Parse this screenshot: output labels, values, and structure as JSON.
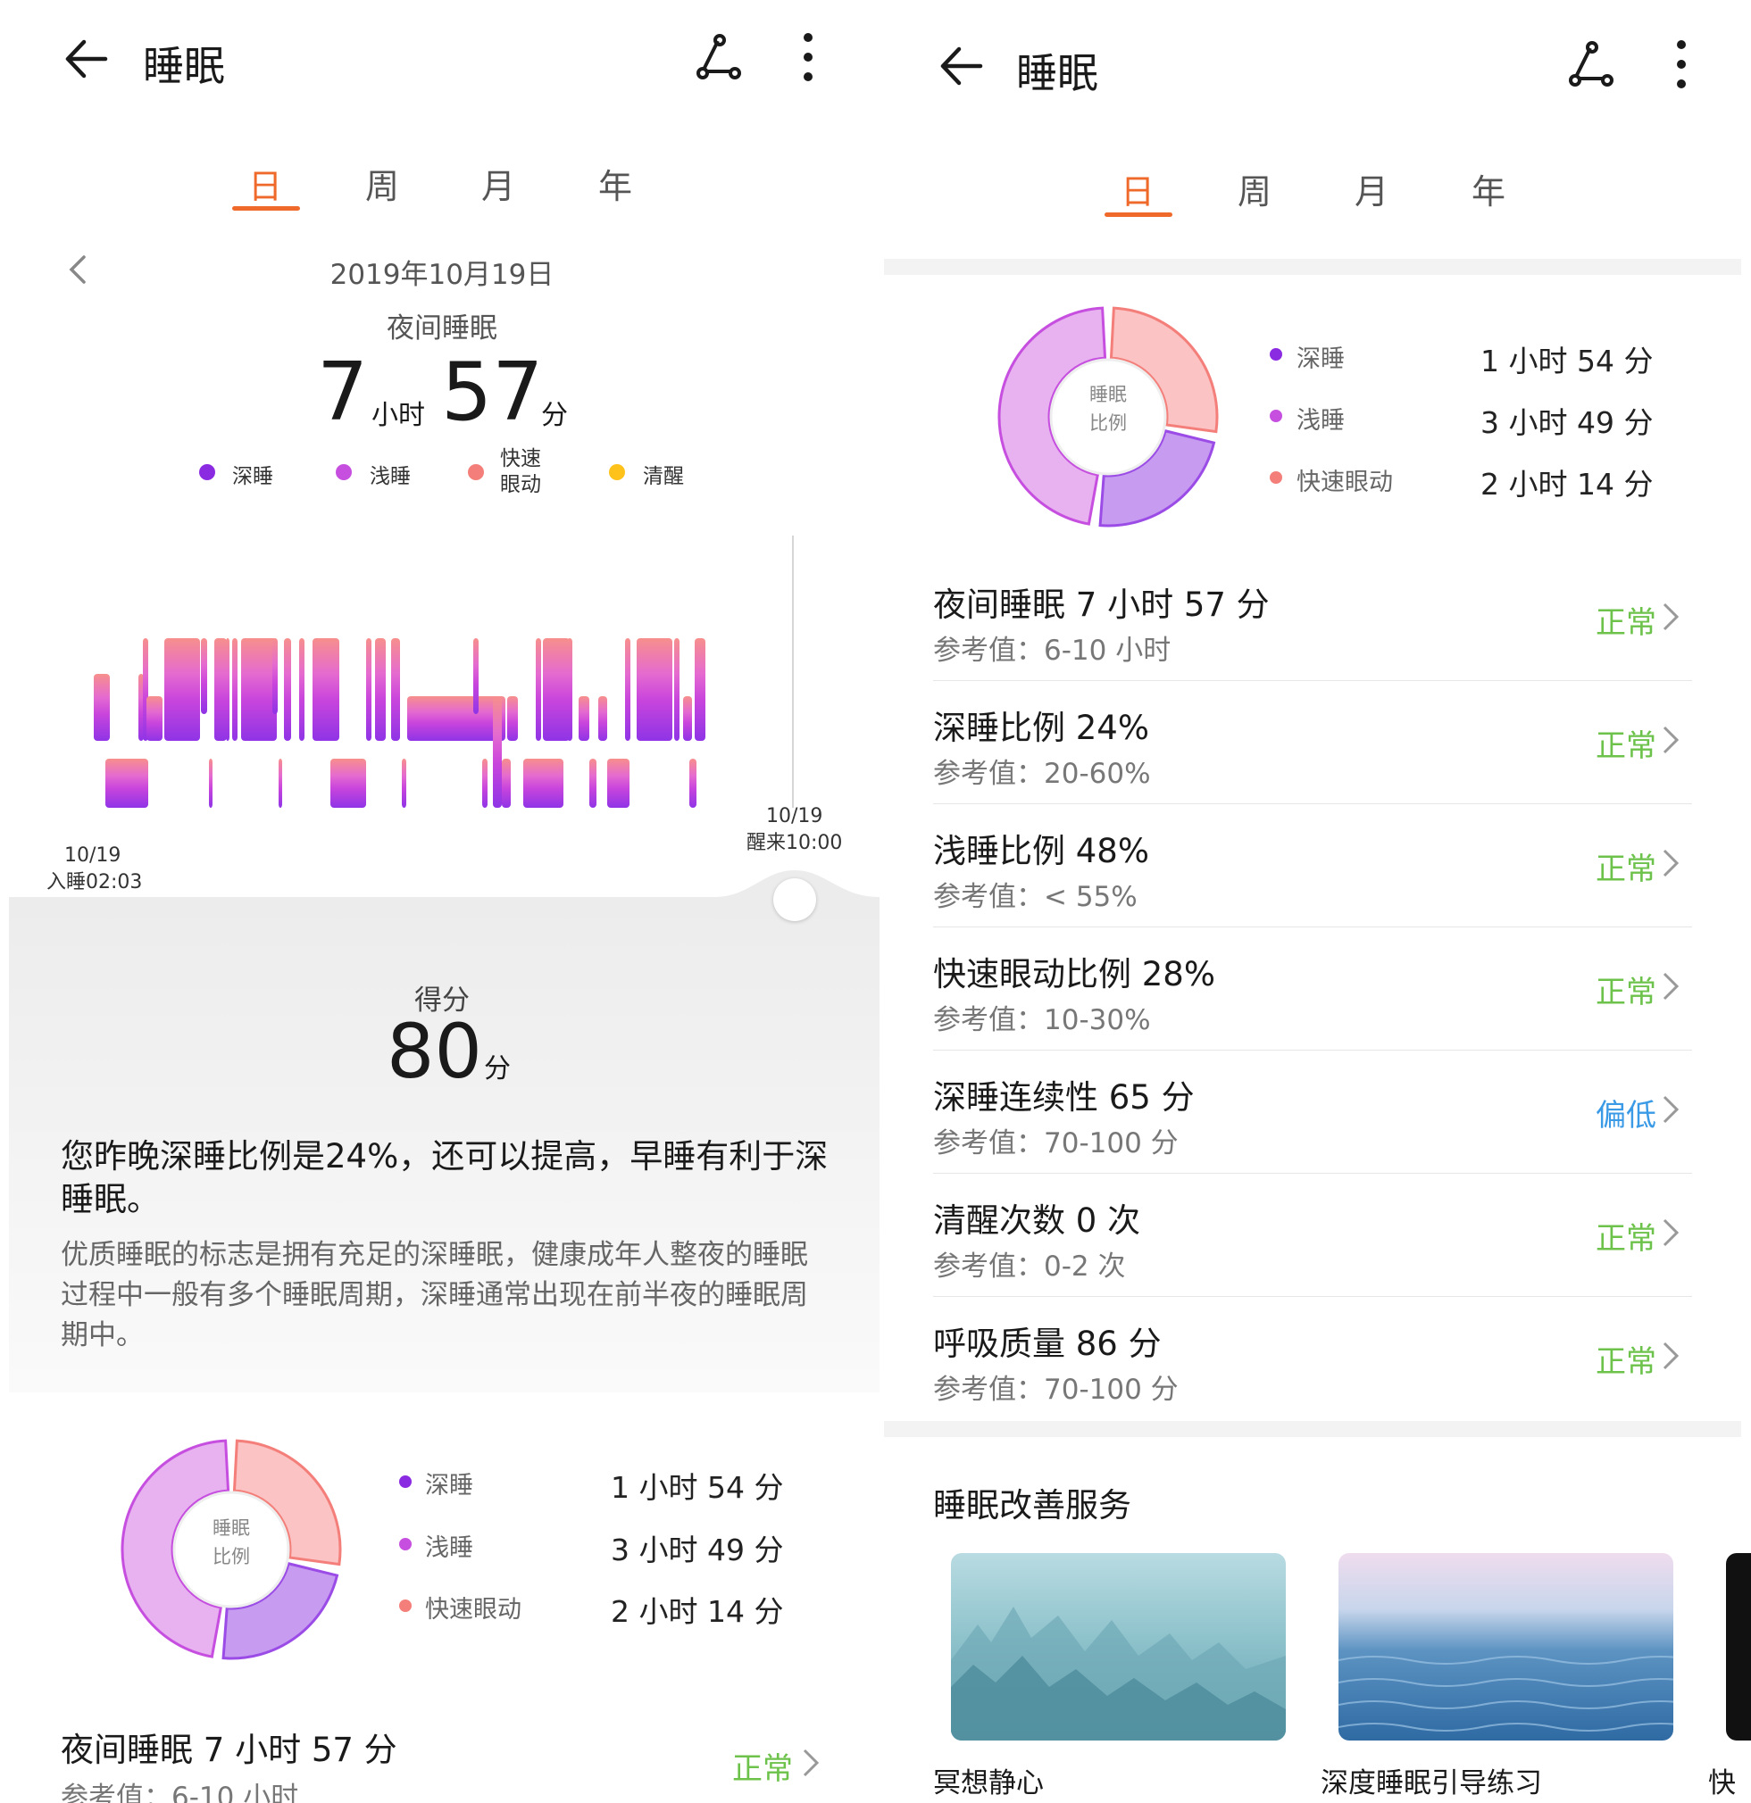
{
  "header": {
    "title": "睡眠"
  },
  "tabs": [
    "日",
    "周",
    "月",
    "年"
  ],
  "date": "2019年10月19日",
  "summary": {
    "label": "夜间睡眠",
    "hours": "7",
    "hour_unit": "小时",
    "minutes": "57",
    "minute_unit": "分"
  },
  "legend": [
    {
      "label": "深睡",
      "color": "#8a2be2"
    },
    {
      "label": "浅睡",
      "color": "#c64fe0"
    },
    {
      "label": "快速\n眼动",
      "color": "#f47f7a"
    },
    {
      "label": "清醒",
      "color": "#ffc21a"
    }
  ],
  "timeline": {
    "start_date": "10/19",
    "start_label": "入睡02:03",
    "end_date": "10/19",
    "end_label": "醒来10:00"
  },
  "score": {
    "label": "得分",
    "value": "80",
    "unit": "分"
  },
  "advice": {
    "headline": "您昨晚深睡比例是24%，还可以提高，早睡有利于深睡眠。",
    "body": "优质睡眠的标志是拥有充足的深睡眠，健康成年人整夜的睡眠过程中一般有多个睡眠周期，深睡通常出现在前半夜的睡眠周期中。"
  },
  "donut": {
    "center_line1": "睡眠",
    "center_line2": "比例",
    "segments": [
      {
        "name": "深睡",
        "percent": 24,
        "color": "#c79cf0"
      },
      {
        "name": "浅睡",
        "percent": 48,
        "color": "#e8b2f0"
      },
      {
        "name": "快速眼动",
        "percent": 28,
        "color": "#fbc3c3"
      }
    ]
  },
  "stats": [
    {
      "label": "深睡",
      "value": "1 小时 54 分",
      "dot": "#8a2be2"
    },
    {
      "label": "浅睡",
      "value": "3 小时 49 分",
      "dot": "#c64fe0"
    },
    {
      "label": "快速眼动",
      "value": "2 小时 14 分",
      "dot": "#f47f7a"
    }
  ],
  "metrics": [
    {
      "title": "夜间睡眠 7 小时 57 分",
      "ref": "参考值：6-10 小时",
      "status": "正常",
      "status_color": "#6cc24a"
    },
    {
      "title": "深睡比例 24%",
      "ref": "参考值：20-60%",
      "status": "正常",
      "status_color": "#6cc24a"
    },
    {
      "title": "浅睡比例 48%",
      "ref": "参考值：< 55%",
      "status": "正常",
      "status_color": "#6cc24a"
    },
    {
      "title": "快速眼动比例 28%",
      "ref": "参考值：10-30%",
      "status": "正常",
      "status_color": "#6cc24a"
    },
    {
      "title": "深睡连续性 65 分",
      "ref": "参考值：70-100 分",
      "status": "偏低",
      "status_color": "#3a9ae6"
    },
    {
      "title": "清醒次数 0 次",
      "ref": "参考值：0-2 次",
      "status": "正常",
      "status_color": "#6cc24a"
    },
    {
      "title": "呼吸质量 86 分",
      "ref": "参考值：70-100 分",
      "status": "正常",
      "status_color": "#6cc24a"
    }
  ],
  "services": {
    "title": "睡眠改善服务",
    "items": [
      "冥想静心",
      "深度睡眠引导练习",
      "快"
    ]
  }
}
